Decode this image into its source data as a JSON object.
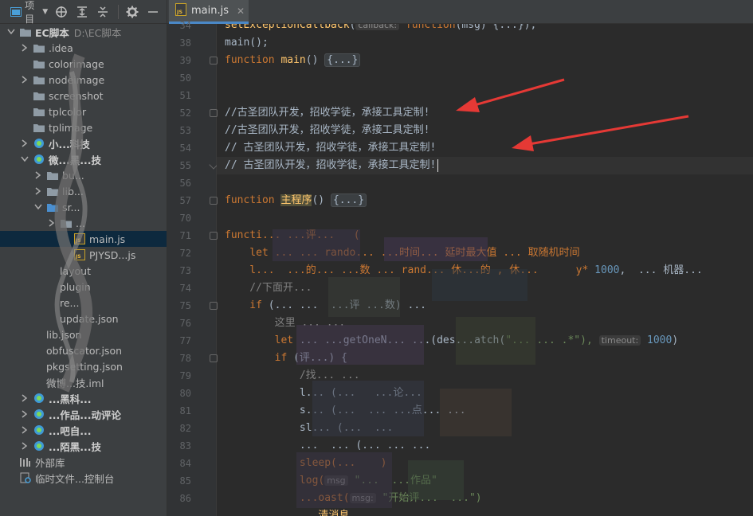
{
  "toolbar": {
    "project_label": "项目"
  },
  "tree": [
    {
      "indent": 0,
      "arrow": "down",
      "icon": "folder",
      "label": "EC脚本",
      "bold": true,
      "path": "D:\\EC脚本"
    },
    {
      "indent": 1,
      "arrow": "right",
      "icon": "folder",
      "label": ".idea"
    },
    {
      "indent": 1,
      "arrow": "none",
      "icon": "folder",
      "label": "colorimage"
    },
    {
      "indent": 1,
      "arrow": "right",
      "icon": "folder",
      "label": "nodeimage"
    },
    {
      "indent": 1,
      "arrow": "none",
      "icon": "folder",
      "label": "screenshot"
    },
    {
      "indent": 1,
      "arrow": "none",
      "icon": "folder",
      "label": "tplcolor"
    },
    {
      "indent": 1,
      "arrow": "none",
      "icon": "folder",
      "label": "tplimage"
    },
    {
      "indent": 1,
      "arrow": "right",
      "icon": "module",
      "label": "小...科技",
      "bold": true
    },
    {
      "indent": 1,
      "arrow": "down",
      "icon": "module",
      "label": "微...黑...技",
      "bold": true
    },
    {
      "indent": 2,
      "arrow": "right",
      "icon": "folder",
      "label": "bu..."
    },
    {
      "indent": 2,
      "arrow": "right",
      "icon": "folder",
      "label": "lib..."
    },
    {
      "indent": 2,
      "arrow": "down",
      "icon": "folder-blue",
      "label": "sr..."
    },
    {
      "indent": 3,
      "arrow": "right",
      "icon": "folder",
      "label": "..."
    },
    {
      "indent": 4,
      "arrow": "none",
      "icon": "js",
      "label": "main.js",
      "selected": true
    },
    {
      "indent": 4,
      "arrow": "none",
      "icon": "js",
      "label": "PJYSD...js"
    },
    {
      "indent": 3,
      "arrow": "none",
      "icon": "none",
      "label": "layout"
    },
    {
      "indent": 3,
      "arrow": "none",
      "icon": "none",
      "label": "plugin"
    },
    {
      "indent": 3,
      "arrow": "none",
      "icon": "none",
      "label": "re..."
    },
    {
      "indent": 3,
      "arrow": "none",
      "icon": "none",
      "label": "update.json"
    },
    {
      "indent": 2,
      "arrow": "none",
      "icon": "none",
      "label": "lib.json"
    },
    {
      "indent": 2,
      "arrow": "none",
      "icon": "none",
      "label": "obfuscator.json"
    },
    {
      "indent": 2,
      "arrow": "none",
      "icon": "none",
      "label": "pkgsetting.json"
    },
    {
      "indent": 2,
      "arrow": "none",
      "icon": "none",
      "label": "微博...技.iml"
    },
    {
      "indent": 1,
      "arrow": "right",
      "icon": "module",
      "label": "...黑科...",
      "bold": true
    },
    {
      "indent": 1,
      "arrow": "right",
      "icon": "module",
      "label": "...作品...动评论",
      "bold": true
    },
    {
      "indent": 1,
      "arrow": "right",
      "icon": "module",
      "label": "...吧自...",
      "bold": true
    },
    {
      "indent": 1,
      "arrow": "right",
      "icon": "module",
      "label": "...陌黑...技",
      "bold": true
    },
    {
      "indent": 0,
      "arrow": "none",
      "icon": "library",
      "label": "外部库"
    },
    {
      "indent": 0,
      "arrow": "none",
      "icon": "scratch",
      "label": "临时文件...控制台"
    }
  ],
  "editor": {
    "tab_label": "main.js",
    "line_numbers": [
      "34",
      "38",
      "39",
      "50",
      "51",
      "52",
      "53",
      "54",
      "55",
      "56",
      "57",
      "70",
      "71",
      "72",
      "73",
      "74",
      "75",
      "76",
      "77",
      "78",
      "79",
      "80",
      "81",
      "82",
      "83",
      "84",
      "85",
      "86",
      ""
    ],
    "text": {
      "l34_fn": "setExceptionCallback",
      "l34_hint": "callback:",
      "l34_kw": "function",
      "l34_rest": "(msg) {...});",
      "l38": "main();",
      "l39_kw": "function",
      "l39_fn": "main",
      "l39_rest": "() ",
      "fold_dots": "{...}",
      "l52": "//古圣团队开发，招收学徒，承接工具定制!",
      "l53": "//古圣团队开发，招收学徒，承接工具定制!",
      "l54": "// 古圣团队开发，招收学徒，承接工具定制!",
      "l55": "// 古圣团队开发，招收学徒，承接工具定制!",
      "l57_kw": "function",
      "l57_fn": "主程序",
      "l57_rest": "() ",
      "l71": "functi... ...评...   (",
      "l72": "    let ... ... rando... ...时间... 延时最大值 ... 取随机时间",
      "l73_a": "    l...  ...的... ...数 ... rand... 休...的 , 休...      y* ",
      "l73_num": "1000",
      "l73_b": ",  ... 机器...",
      "l74": "    //下面开...",
      "l75_kw": "    if",
      "l75_rest": " (... ...  ...评 ...数) ...",
      "l76": "        这里 ... ...",
      "l77_kw": "        let",
      "l77_a": " ... ...getOneN... ...(des...atch(",
      "l77_b": "\"... ... .*\"),",
      "l77_hint": "timeout:",
      "l77_num": "1000",
      "l78_kw": "        if",
      "l78_rest": " (评...) {",
      "l79": "            /找... ...",
      "l80": "            l... (...   ...论...",
      "l81": "            s... (...  ... ...点... ...",
      "l82": "            sl... (...  ...",
      "l83": "            ...  ... (... ... ...",
      "l84": "            sleep(...    )",
      "l85_a": "            log(",
      "l85_hint": "msg",
      "l85_str": "\"...  ...作品\"",
      "l86_a": "            ...oast(",
      "l86_hint": "msg:",
      "l86_str": "\"开始评...  ...\")",
      "l87": "            ...清消息..."
    }
  },
  "colors": {
    "background": "#2b2b2b",
    "panel": "#3c3f41",
    "keyword": "#cc7832",
    "function": "#ffc66d",
    "number": "#6897bb",
    "string": "#6a8759",
    "selection": "#0d293e",
    "arrow_annotation": "#e53935"
  }
}
